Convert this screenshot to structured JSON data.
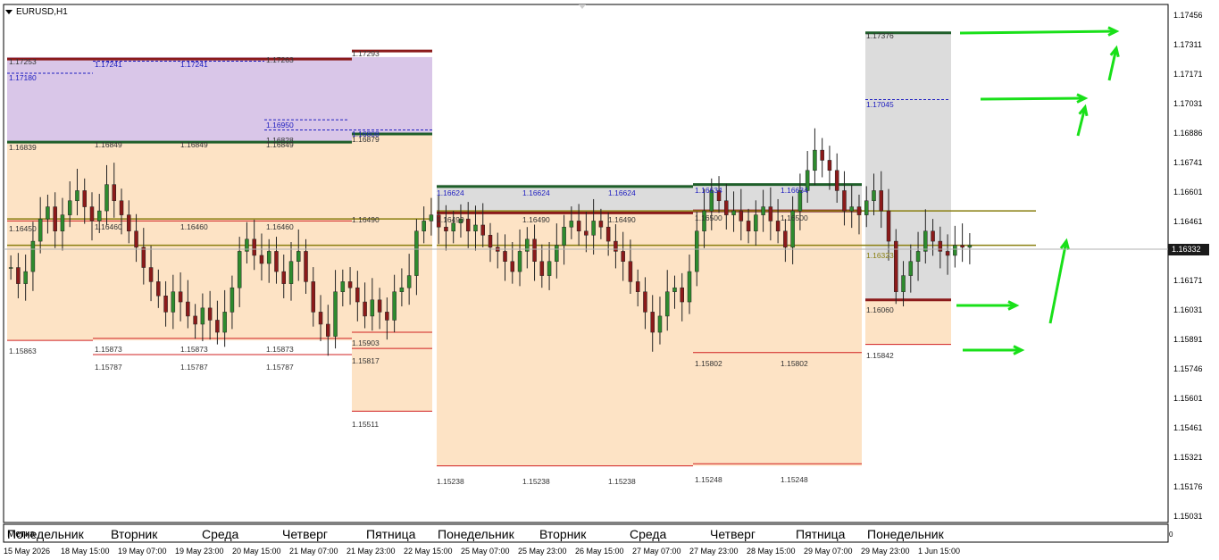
{
  "window": {
    "symbol_label": "EURUSD,H1",
    "overlay_word": "Метка",
    "axis_zero": "0"
  },
  "price_axis": {
    "labels": [
      "1.17456",
      "1.17311",
      "1.17171",
      "1.17031",
      "1.16886",
      "1.16741",
      "1.16601",
      "1.16461",
      "1.16332",
      "1.16171",
      "1.16031",
      "1.15891",
      "1.15746",
      "1.15601",
      "1.15461",
      "1.15321",
      "1.15176",
      "1.15031"
    ],
    "current_price": "1.16332"
  },
  "time_axis": {
    "labels": [
      "15 May 2026",
      "18 May 15:00",
      "19 May 07:00",
      "19 May 23:00",
      "20 May 15:00",
      "21 May 07:00",
      "21 May 23:00",
      "22 May 15:00",
      "25 May 07:00",
      "25 May 23:00",
      "26 May 15:00",
      "27 May 07:00",
      "27 May 23:00",
      "28 May 15:00",
      "29 May 07:00",
      "29 May 23:00",
      "1 Jun 15:00"
    ]
  },
  "day_labels": [
    "Понедельник",
    "Вторник",
    "Среда",
    "Четверг",
    "Пятница",
    "Понедельник",
    "Вторник",
    "Среда",
    "Четверг",
    "Пятница",
    "Понедельник"
  ],
  "levels": {
    "week1": [
      "1.17253",
      "1.17180",
      "1.17241",
      "1.17241",
      "1.17263",
      "1.16839",
      "1.16849",
      "1.16849",
      "1.16849",
      "1.16450",
      "1.16460",
      "1.16460",
      "1.16460",
      "1.15863",
      "1.15873",
      "1.15873",
      "1.15873",
      "1.15787",
      "1.15787",
      "1.15787",
      "1.16950",
      "1.16828"
    ],
    "week1_fri": [
      "1.17293",
      "1.16879",
      "1.16808",
      "1.16490",
      "1.15903",
      "1.15817",
      "1.15511"
    ],
    "week2": [
      "1.16624",
      "1.16624",
      "1.16624",
      "1.16634",
      "1.16634",
      "1.16490",
      "1.16490",
      "1.16490",
      "1.16500",
      "1.16500",
      "1.15238",
      "1.15238",
      "1.15238",
      "1.15248",
      "1.15248",
      "1.15802",
      "1.15802"
    ],
    "week3": [
      "1.17376",
      "1.17045",
      "1.16323",
      "1.16060",
      "1.15842"
    ]
  },
  "colors": {
    "purple_zone": "#d9c6e8",
    "peach_zone": "#fde3c5",
    "grey_zone": "#dcdcdc",
    "dark_green": "#1f5f2a",
    "dark_red": "#8b1a1a",
    "red_line": "#d02020",
    "olive": "#8a7f10",
    "blue_dash": "#2020c0",
    "arrow_green": "#19e019",
    "bull": "#2e8b2e",
    "bear": "#8b1a1a"
  },
  "chart_data": {
    "type": "candlestick",
    "title": "EURUSD,H1",
    "ylim": [
      1.1496,
      1.1752
    ],
    "close_path": [
      1.1622,
      1.1614,
      1.162,
      1.1635,
      1.1646,
      1.1652,
      1.164,
      1.1648,
      1.1655,
      1.166,
      1.1652,
      1.1645,
      1.165,
      1.1663,
      1.1655,
      1.1648,
      1.164,
      1.1632,
      1.1622,
      1.1615,
      1.1608,
      1.16,
      1.161,
      1.1605,
      1.1598,
      1.1594,
      1.1602,
      1.1596,
      1.159,
      1.16,
      1.1612,
      1.163,
      1.1636,
      1.1628,
      1.1624,
      1.163,
      1.162,
      1.1614,
      1.1625,
      1.163,
      1.1615,
      1.16,
      1.1594,
      1.1588,
      1.161,
      1.1615,
      1.1612,
      1.1605,
      1.1598,
      1.1606,
      1.16,
      1.1596,
      1.161,
      1.1612,
      1.1618,
      1.164,
      1.1645,
      1.1648,
      1.1642,
      1.164,
      1.1644,
      1.1646,
      1.164,
      1.1643,
      1.1638,
      1.1632,
      1.163,
      1.1625,
      1.162,
      1.163,
      1.1636,
      1.1625,
      1.1618,
      1.1625,
      1.1633,
      1.1642,
      1.1645,
      1.164,
      1.1638,
      1.1645,
      1.1642,
      1.1635,
      1.163,
      1.1625,
      1.1615,
      1.161,
      1.16,
      1.159,
      1.1598,
      1.161,
      1.1612,
      1.1605,
      1.162,
      1.164,
      1.165,
      1.166,
      1.1655,
      1.1648,
      1.165,
      1.1645,
      1.164,
      1.1648,
      1.1652,
      1.1645,
      1.164,
      1.1632,
      1.165,
      1.166,
      1.167,
      1.168,
      1.1675,
      1.167,
      1.166,
      1.165,
      1.1652,
      1.1648,
      1.1655,
      1.166,
      1.165,
      1.1635,
      1.161,
      1.1618,
      1.1625,
      1.163,
      1.164,
      1.1635,
      1.163,
      1.1628,
      1.1633,
      1.1632,
      1.1633
    ]
  }
}
